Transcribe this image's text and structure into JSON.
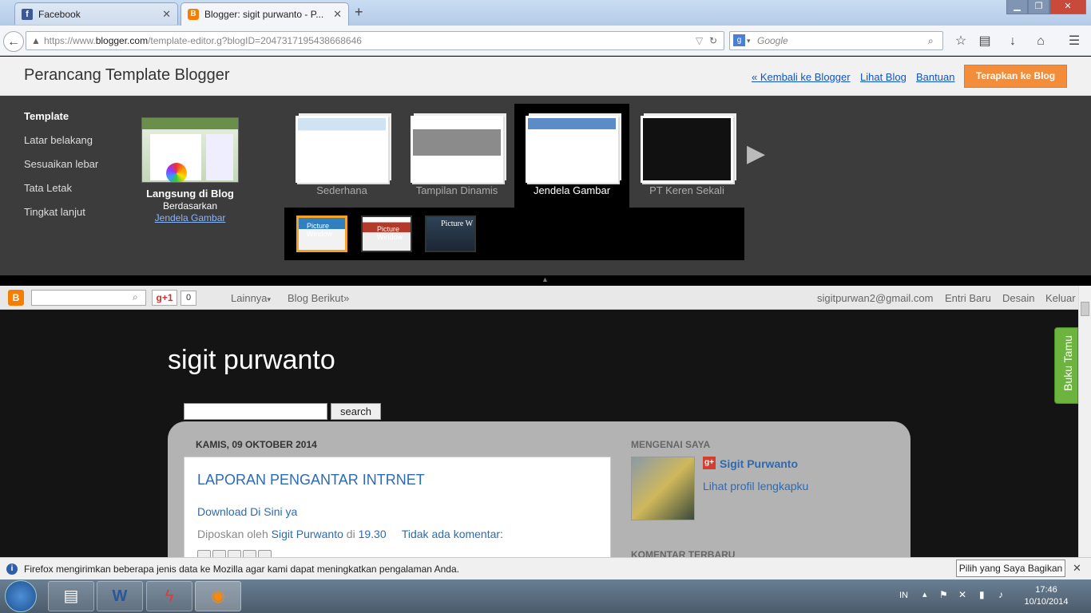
{
  "browser": {
    "tabs": [
      {
        "label": "Facebook",
        "icon": "facebook-icon"
      },
      {
        "label": "Blogger: sigit purwanto - P...",
        "icon": "blogger-icon"
      }
    ],
    "url": "https://www.blogger.com/template-editor.g?blogID=2047317195438668646",
    "url_domain": "blogger.com",
    "url_prefix": "https://www.",
    "url_suffix": "/template-editor.g?blogID=2047317195438668646",
    "search_placeholder": "Google"
  },
  "designer": {
    "title": "Perancang Template Blogger",
    "links": [
      "« Kembali ke Blogger",
      "Lihat Blog",
      "Bantuan"
    ],
    "apply_label": "Terapkan ke Blog",
    "sidebar": [
      "Template",
      "Latar belakang",
      "Sesuaikan lebar",
      "Tata Letak",
      "Tingkat lanjut"
    ],
    "current": {
      "title": "Langsung di Blog",
      "based_on": "Berdasarkan",
      "template_link": "Jendela Gambar"
    },
    "templates": [
      "Sederhana",
      "Tampilan Dinamis",
      "Jendela Gambar",
      "PT Keren Sekali"
    ],
    "selected_template": "Jendela Gambar",
    "variants": [
      "Picture Window",
      "Picture Window",
      "Picture W"
    ]
  },
  "blog": {
    "bar": {
      "gplus_label": "g+1",
      "gplus_count": "0",
      "more": "Lainnya",
      "next_blog": "Blog Berikut»",
      "email": "sigitpurwan2@gmail.com",
      "new_post": "Entri Baru",
      "design": "Desain",
      "logout": "Keluar"
    },
    "title": "sigit purwanto",
    "search_button": "search",
    "post": {
      "date": "KAMIS, 09 OKTOBER 2014",
      "title": "LAPORAN PENGANTAR INTRNET",
      "link": "Download Di Sini ya",
      "meta_prefix": "Diposkan oleh",
      "author": "Sigit Purwanto",
      "meta_at": "di",
      "time": "19.30",
      "comments": "Tidak ada komentar:"
    },
    "about_header": "MENGENAI SAYA",
    "profile_name": "Sigit Purwanto",
    "profile_link": "Lihat profil lengkapku",
    "recent_header": "KOMENTAR TERBARU",
    "guestbook": "Buku Tamu"
  },
  "notification": {
    "text": "Firefox mengirimkan beberapa jenis data ke Mozilla agar kami dapat meningkatkan pengalaman Anda.",
    "button": "Pilih yang Saya Bagikan"
  },
  "taskbar": {
    "language": "IN",
    "time": "17:46",
    "date": "10/10/2014"
  },
  "colors": {
    "apply_button": "#f48d3a",
    "link_blue": "#2c6bb3",
    "selected_variant_border": "#f4a325"
  }
}
